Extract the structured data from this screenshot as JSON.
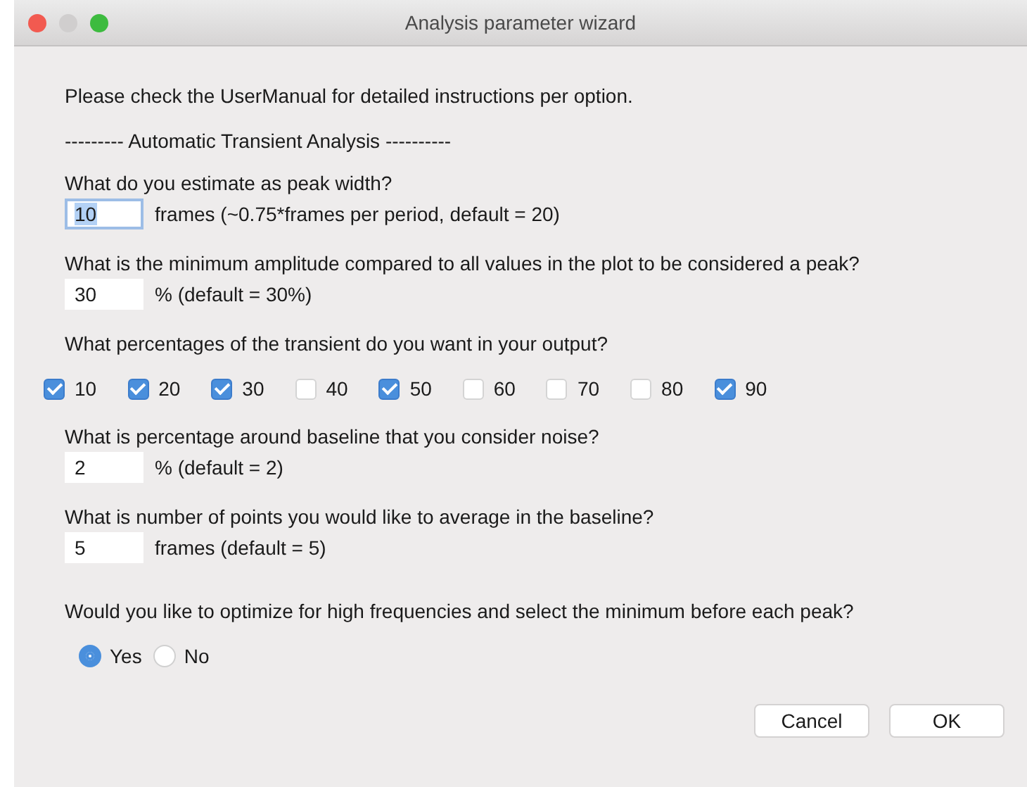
{
  "window": {
    "title": "Analysis parameter wizard"
  },
  "intro": "Please check the UserManual for detailed instructions per option.",
  "section_heading": "--------- Automatic Transient Analysis ----------",
  "peak_width": {
    "question": "What do you estimate as peak width?",
    "value": "10",
    "focused": true,
    "hint": "frames (~0.75*frames per period, default = 20)"
  },
  "min_amplitude": {
    "question": "What is the minimum amplitude compared to all values in the plot to be considered a peak?",
    "value": "30",
    "focused": false,
    "hint": "% (default = 30%)"
  },
  "percentages": {
    "question": "What percentages of the transient do you want in your output?",
    "options": [
      {
        "label": "10",
        "checked": true
      },
      {
        "label": "20",
        "checked": true
      },
      {
        "label": "30",
        "checked": true
      },
      {
        "label": "40",
        "checked": false
      },
      {
        "label": "50",
        "checked": true
      },
      {
        "label": "60",
        "checked": false
      },
      {
        "label": "70",
        "checked": false
      },
      {
        "label": "80",
        "checked": false
      },
      {
        "label": "90",
        "checked": true
      }
    ]
  },
  "noise": {
    "question": "What is percentage around baseline that you consider noise?",
    "value": "2",
    "focused": false,
    "hint": "% (default = 2)"
  },
  "baseline_points": {
    "question": "What is number of points you would like to average in the baseline?",
    "value": "5",
    "focused": false,
    "hint": "frames (default = 5)"
  },
  "optimize": {
    "question": "Would you like to optimize for high frequencies and select the minimum before each peak?",
    "options": [
      {
        "label": "Yes",
        "selected": true
      },
      {
        "label": "No",
        "selected": false
      }
    ]
  },
  "buttons": [
    "Cancel",
    "OK"
  ]
}
